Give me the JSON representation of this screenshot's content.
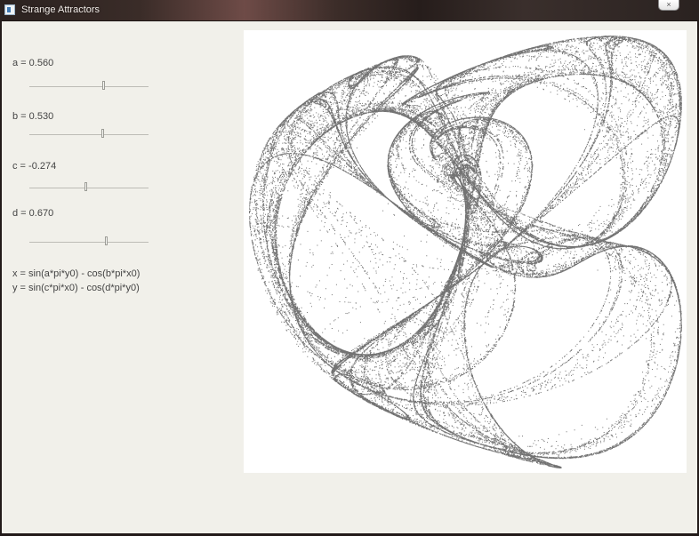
{
  "window": {
    "title": "Strange Attractors",
    "close_label": "×"
  },
  "params": [
    {
      "name": "a",
      "label": "a = 0.560",
      "value": 0.56,
      "slider_fraction": 0.62
    },
    {
      "name": "b",
      "label": "b = 0.530",
      "value": 0.53,
      "slider_fraction": 0.61
    },
    {
      "name": "c",
      "label": "c = -0.274",
      "value": -0.274,
      "slider_fraction": 0.47
    },
    {
      "name": "d",
      "label": "d = 0.670",
      "value": 0.67,
      "slider_fraction": 0.64
    }
  ],
  "formulas": {
    "x": "x = sin(a*pi*y0) - cos(b*pi*x0)",
    "y": "y = sin(c*pi*x0) - cos(d*pi*y0)"
  },
  "canvas": {
    "background": "#ffffff",
    "point_color": "#000000"
  },
  "icons": {
    "app": "window-app-icon",
    "close": "close-icon"
  }
}
